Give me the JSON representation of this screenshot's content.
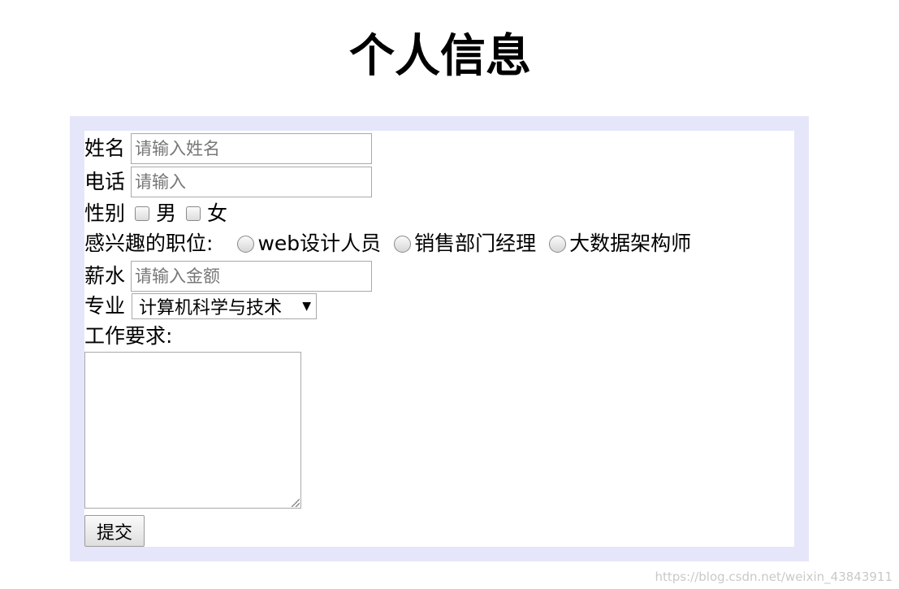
{
  "page": {
    "title": "个人信息"
  },
  "form": {
    "name": {
      "label": "姓名",
      "placeholder": "请输入姓名"
    },
    "phone": {
      "label": "电话",
      "placeholder": "请输入"
    },
    "gender": {
      "label": "性别",
      "options": [
        "男",
        "女"
      ]
    },
    "position": {
      "label": "感兴趣的职位:",
      "options": [
        "web设计人员",
        "销售部门经理",
        "大数据架构师"
      ]
    },
    "salary": {
      "label": "薪水",
      "placeholder": "请输入金额"
    },
    "major": {
      "label": "专业",
      "selected": "计算机科学与技术"
    },
    "requirements": {
      "label": "工作要求:"
    },
    "submit_label": "提交"
  },
  "watermark": "https://blog.csdn.net/weixin_43843911"
}
